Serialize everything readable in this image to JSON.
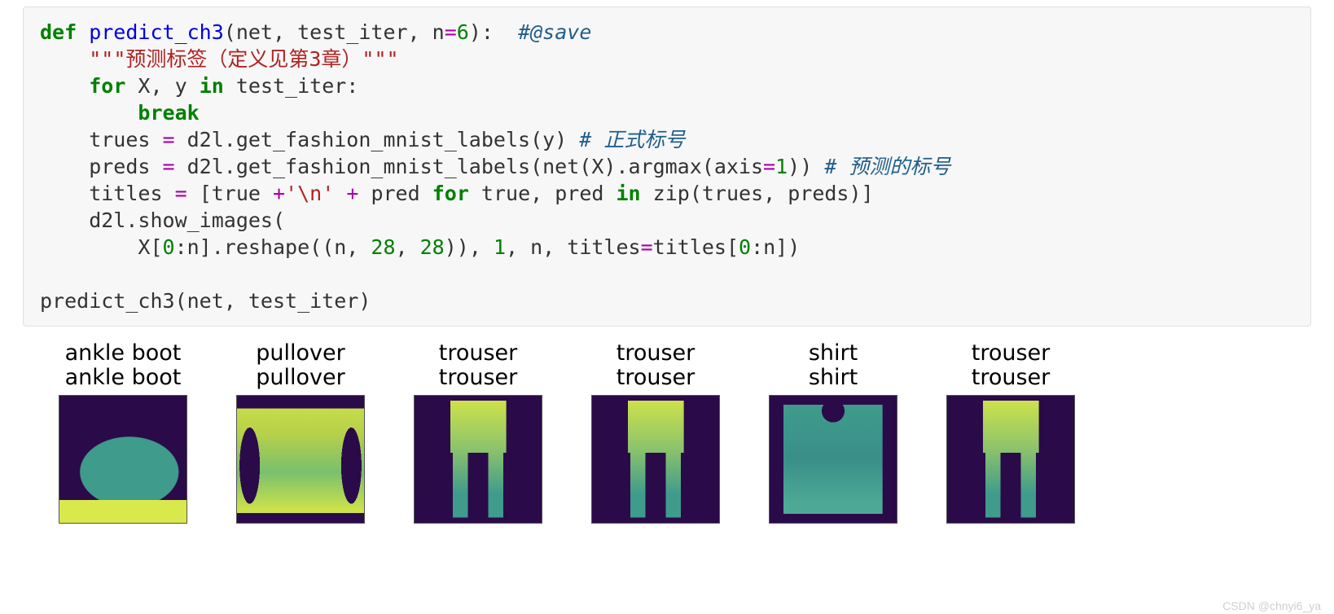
{
  "code": {
    "line1": {
      "def": "def",
      "fn": " predict_ch3",
      "params": "(net, test_iter, n",
      "eq": "=",
      "n": "6",
      "close": "):  ",
      "com": "#@save"
    },
    "line2": "\"\"\"预测标签（定义见第3章）\"\"\"",
    "line3": {
      "for": "for",
      "body": " X, y ",
      "in": "in",
      "rest": " test_iter:"
    },
    "line4": "break",
    "line5": {
      "text": "    trues ",
      "eq": "=",
      "rest": " d2l.get_fashion_mnist_labels(y) ",
      "com": "# 正式标号"
    },
    "line6": {
      "text": "    preds ",
      "eq": "=",
      "rest1": " d2l.get_fashion_mnist_labels(net(X).argmax(axis",
      "eq2": "=",
      "n": "1",
      "rest2": ")) ",
      "com": "# 预测的标号"
    },
    "line7": {
      "text": "    titles ",
      "eq": "=",
      "rest1": " [true ",
      "plus1": "+",
      "sn": "'\\n'",
      "sp": " ",
      "plus2": "+",
      "rest2": " pred ",
      "for": "for",
      "rest3": " true, pred ",
      "in": "in",
      "rest4": " zip(trues, preds)]"
    },
    "line8": "    d2l.show_images(",
    "line9": {
      "pre": "        X[",
      "z": "0",
      "mid": ":n].reshape((n, ",
      "a": "28",
      ", ": "",
      "b": "28",
      "post": ")), ",
      "one": "1",
      ", n, titles": "",
      "eq": "=",
      "rest": "titles[",
      "z2": "0",
      "rest2": ":n])"
    },
    "line10": "",
    "line11": "predict_ch3(net, test_iter)"
  },
  "gallery": [
    {
      "true": "ankle boot",
      "pred": "ankle boot",
      "cls": "boot"
    },
    {
      "true": "pullover",
      "pred": "pullover",
      "cls": "pullover"
    },
    {
      "true": "trouser",
      "pred": "trouser",
      "cls": "trouser"
    },
    {
      "true": "trouser",
      "pred": "trouser",
      "cls": "trouser"
    },
    {
      "true": "shirt",
      "pred": "shirt",
      "cls": "shirt"
    },
    {
      "true": "trouser",
      "pred": "trouser",
      "cls": "trouser"
    }
  ],
  "watermark": "CSDN @chnyi6_ya"
}
